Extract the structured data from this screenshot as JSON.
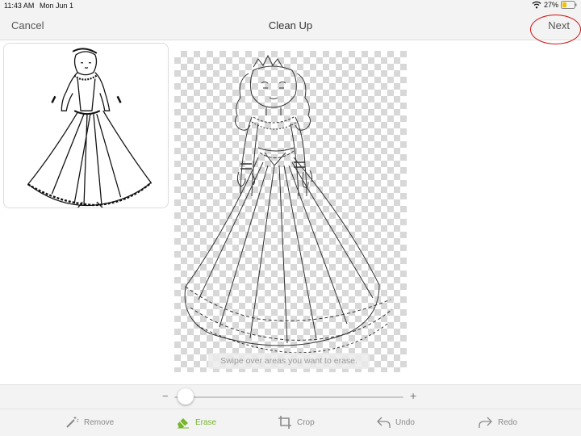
{
  "status_bar": {
    "time": "11:43 AM",
    "date": "Mon Jun 1",
    "battery": "27%"
  },
  "nav": {
    "cancel_label": "Cancel",
    "title": "Clean Up",
    "next_label": "Next"
  },
  "canvas": {
    "hint": "Swipe over areas you want to erase."
  },
  "slider": {
    "minus": "−",
    "plus": "+",
    "value": 0.05
  },
  "toolbar": {
    "active_color": "#76b72a",
    "items": [
      {
        "label": "Remove",
        "icon": "magic-wand-icon",
        "active": false
      },
      {
        "label": "Erase",
        "icon": "eraser-icon",
        "active": true
      },
      {
        "label": "Crop",
        "icon": "crop-icon",
        "active": false
      },
      {
        "label": "Undo",
        "icon": "undo-icon",
        "active": false
      },
      {
        "label": "Redo",
        "icon": "redo-icon",
        "active": false
      }
    ]
  }
}
